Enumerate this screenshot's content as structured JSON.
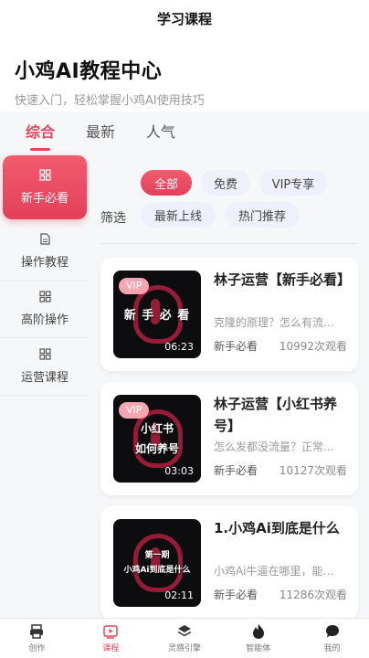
{
  "topbar": {
    "title": "学习课程"
  },
  "hero": {
    "title": "小鸡AI教程中心",
    "subtitle": "快速入门，轻松掌握小鸡AI使用技巧"
  },
  "tabs": [
    {
      "label": "综合",
      "active": true
    },
    {
      "label": "最新",
      "active": false
    },
    {
      "label": "人气",
      "active": false
    }
  ],
  "sidebar": {
    "items": [
      {
        "label": "新手必看",
        "icon": "grid-icon",
        "active": true
      },
      {
        "label": "操作教程",
        "icon": "document-icon",
        "active": false
      },
      {
        "label": "高阶操作",
        "icon": "grid-icon",
        "active": false
      },
      {
        "label": "运营课程",
        "icon": "grid-icon",
        "active": false
      }
    ]
  },
  "filter": {
    "label": "筛选",
    "chips": [
      {
        "label": "全部",
        "active": true
      },
      {
        "label": "免费",
        "active": false
      },
      {
        "label": "VIP专享",
        "active": false
      },
      {
        "label": "最新上线",
        "active": false
      },
      {
        "label": "热门推荐",
        "active": false
      }
    ]
  },
  "courses": [
    {
      "vip": "VIP",
      "cover_text": "新 手 必 看",
      "duration": "06:23",
      "title": "林子运营【新手必看】",
      "desc": "克隆的原理？怎么有流…",
      "tag": "新手必看",
      "views": "10992次观看"
    },
    {
      "vip": "VIP",
      "cover_text": "小红书",
      "cover_text2": "如何养号",
      "duration": "03:03",
      "title": "林子运营【小红书养号】",
      "desc": "怎么发都没流量？正常…",
      "tag": "新手必看",
      "views": "10127次观看"
    },
    {
      "vip": "",
      "cover_text": "第一期",
      "cover_text2": "小鸡Ai到底是什么",
      "duration": "02:11",
      "title": "1.小鸡Ai到底是什么",
      "desc": "小鸡Ai牛逼在哪里，能…",
      "tag": "新手必看",
      "views": "11286次观看"
    }
  ],
  "bottom_nav": [
    {
      "label": "创作",
      "icon": "printer-icon",
      "active": false
    },
    {
      "label": "课程",
      "icon": "play-video-icon",
      "active": true
    },
    {
      "label": "灵感引擎",
      "icon": "layers-icon",
      "active": false
    },
    {
      "label": "智能体",
      "icon": "flame-icon",
      "active": false
    },
    {
      "label": "我的",
      "icon": "chat-icon",
      "active": false
    }
  ],
  "colors": {
    "accent": "#e5475c",
    "vip_badge": "#f6a6b2",
    "panel_bg": "#f6f7f9"
  }
}
